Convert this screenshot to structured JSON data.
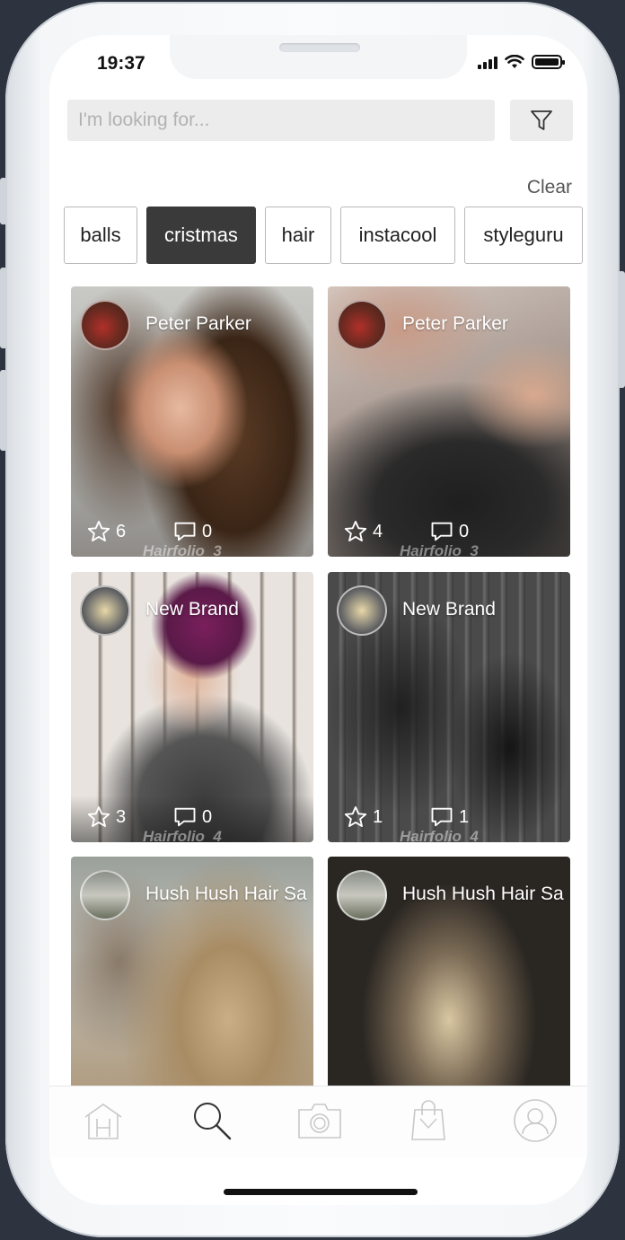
{
  "status_bar": {
    "time": "19:37"
  },
  "search": {
    "placeholder": "I'm looking for..."
  },
  "filters": {
    "clear_label": "Clear"
  },
  "tags": [
    {
      "label": "balls",
      "selected": false
    },
    {
      "label": "cristmas",
      "selected": true
    },
    {
      "label": "hair",
      "selected": false
    },
    {
      "label": "instacool",
      "selected": false
    },
    {
      "label": "styleguru",
      "selected": false
    }
  ],
  "posts": [
    {
      "author": "Peter Parker",
      "stars": "6",
      "comments": "0",
      "watermark": "Hairfolio_3"
    },
    {
      "author": "Peter Parker",
      "stars": "4",
      "comments": "0",
      "watermark": "Hairfolio_3"
    },
    {
      "author": "New Brand",
      "stars": "3",
      "comments": "0",
      "watermark": "Hairfolio_4"
    },
    {
      "author": "New Brand",
      "stars": "1",
      "comments": "1",
      "watermark": "Hairfolio_4"
    },
    {
      "author": "Hush Hush Hair Sa"
    },
    {
      "author": "Hush Hush Hair Sa"
    }
  ],
  "tabbar": {
    "items": [
      {
        "icon": "home-icon",
        "active": false
      },
      {
        "icon": "search-icon",
        "active": true
      },
      {
        "icon": "camera-icon",
        "active": false
      },
      {
        "icon": "shopping-bag-icon",
        "active": false
      },
      {
        "icon": "profile-icon",
        "active": false
      }
    ]
  },
  "colors": {
    "selected_tag": "#3a3a3a",
    "inactive_icon": "#c8c8c8",
    "active_icon": "#333333"
  }
}
